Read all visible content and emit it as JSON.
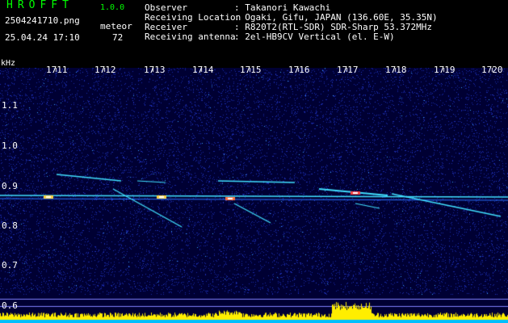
{
  "app": {
    "name": "HROFFT",
    "version": "1.0.0"
  },
  "file": {
    "name": "2504241710.png",
    "timestamp": "25.04.24 17:10"
  },
  "counter": {
    "type": "meteor",
    "count": "72"
  },
  "station": [
    {
      "label": "Observer",
      "value": ": Takanori Kawachi"
    },
    {
      "label": "Receiving Location",
      "value": ": Ogaki, Gifu, JAPAN (136.60E, 35.35N)"
    },
    {
      "label": "Receiver",
      "value": ": R820T2(RTL-SDR) SDR-Sharp 53.372MHz"
    },
    {
      "label": "Receiving antenna",
      "value": ": 2el-HB9CV Vertical (el. E-W)"
    }
  ],
  "spectrogram": {
    "unit_label": "kHz",
    "x_ticks": [
      "1711",
      "1712",
      "1713",
      "1714",
      "1715",
      "1716",
      "1717",
      "1718",
      "1719",
      "1720"
    ],
    "y_ticks": [
      "1.1",
      "1.0",
      "0.9",
      "0.8",
      "0.7",
      "0.6"
    ],
    "colors": {
      "background": "#000033",
      "noise": "#1a2aa8",
      "trace": "#40e0ff",
      "peak": "#ffffff",
      "signal_bar": "#ffee00",
      "baseline": "#00bfff"
    }
  }
}
